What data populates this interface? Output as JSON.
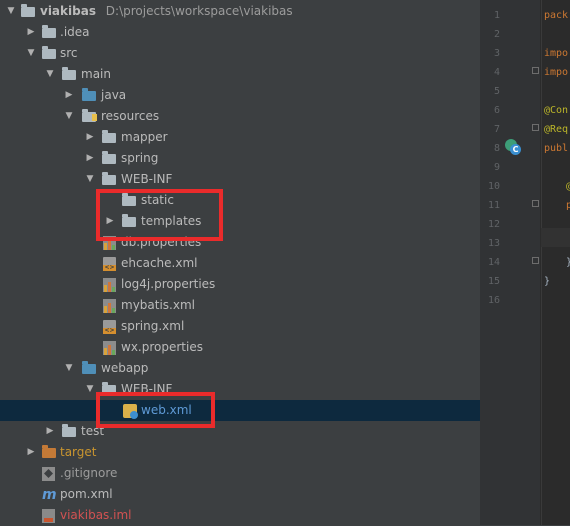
{
  "project": {
    "name": "viakibas",
    "path": "D:\\projects\\workspace\\viakibas"
  },
  "tree": {
    "idea": ".idea",
    "src": "src",
    "main": "main",
    "java": "java",
    "resources": "resources",
    "mapper": "mapper",
    "spring": "spring",
    "web_inf": "WEB-INF",
    "static": "static",
    "templates": "templates",
    "db_properties": "db.properties",
    "ehcache_xml": "ehcache.xml",
    "log4j_properties": "log4j.properties",
    "mybatis_xml": "mybatis.xml",
    "spring_xml": "spring.xml",
    "wx_properties": "wx.properties",
    "webapp": "webapp",
    "webapp_web_inf": "WEB-INF",
    "web_xml": "web.xml",
    "test": "test",
    "target": "target",
    "gitignore": ".gitignore",
    "pom_xml": "pom.xml",
    "iml": "viakibas.iml"
  },
  "colors": {
    "highlight": "#ea2b2b",
    "selection": "#0d293e"
  },
  "editor": {
    "line_numbers": [
      "1",
      "2",
      "3",
      "4",
      "5",
      "6",
      "7",
      "8",
      "9",
      "10",
      "11",
      "12",
      "13",
      "14",
      "15",
      "16"
    ],
    "line1": "pack",
    "line3": "impo",
    "line4": "impo",
    "line6": "@Con",
    "line7": "@Req",
    "line8": "publ",
    "line10": "@",
    "line11": "p",
    "line14": "}",
    "line15": "}",
    "gutter_icon": "C"
  }
}
